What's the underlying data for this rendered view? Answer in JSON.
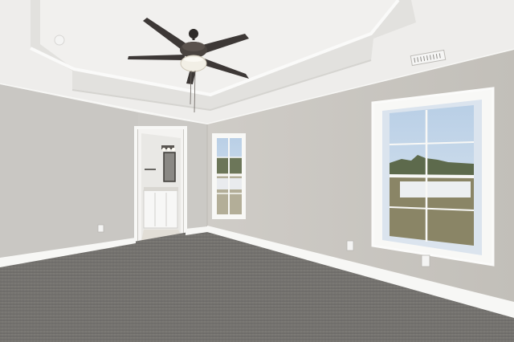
{
  "scene": {
    "kind": "empty bedroom interior photo",
    "elements": [
      "tray-ceiling",
      "ceiling-fan",
      "bathroom-doorway",
      "small-window",
      "large-window",
      "carpet-floor",
      "baseboards",
      "air-vent",
      "outlets"
    ]
  },
  "colors": {
    "ceiling": "#efeeec",
    "tray": "#e2e1de",
    "wall_left": "#c9c7c3",
    "wall_back": "#cfcdc8",
    "wall_right": "#c6c3bd",
    "trim": "#f7f7f5",
    "carpet": "#6d6b68",
    "carpet_far": "#7c7a76",
    "sky": "#c6d8ea",
    "grass": "#8a8566",
    "trees": "#5d6a4c",
    "fan_body": "#3a3533",
    "fan_glass": "#f2efe6"
  }
}
